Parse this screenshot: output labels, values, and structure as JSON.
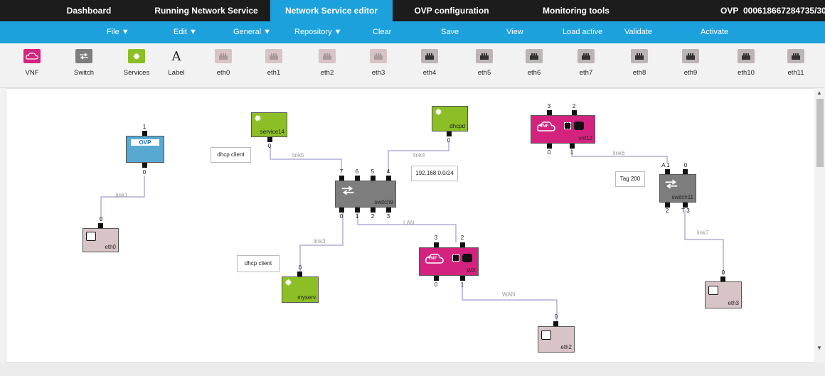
{
  "tabs": [
    "Dashboard",
    "Running Network Service",
    "Network Service editor",
    "OVP configuration",
    "Monitoring tools"
  ],
  "ovp": {
    "label": "OVP",
    "id": "000618667284735/30"
  },
  "menu": {
    "file": "File ▼",
    "edit": "Edit ▼",
    "general": "General ▼",
    "repository": "Repository ▼",
    "clear": "Clear",
    "save": "Save",
    "view": "View",
    "load_active": "Load active",
    "validate": "Validate",
    "activate": "Activate"
  },
  "palette": [
    "VNF",
    "Switch",
    "Services",
    "Label",
    "eth0",
    "eth1",
    "eth2",
    "eth3",
    "eth4",
    "eth5",
    "eth6",
    "eth7",
    "eth8",
    "eth9",
    "eth10",
    "eth11"
  ],
  "nodes": {
    "service14": "service14",
    "dhcpd": "dhcpd",
    "vnf12": "vnf12",
    "ovp_badge": "OVP",
    "switch9": "switch9",
    "switch11": "switch11",
    "eth0": "eth0",
    "myserv": "myserv",
    "wx": "WX",
    "eth3": "eth3",
    "eth2": "eth2",
    "vnf_badge": "VNF"
  },
  "notes": {
    "dhcp_client_1": "dhcp client",
    "subnet": "192.168.0.0/24",
    "tag": "Tag 200",
    "dhcp_client_2": "dhcp client"
  },
  "links": {
    "link1": "link1",
    "link3": "link3",
    "link4": "link4",
    "link5": "link5",
    "link6": "link6",
    "link7": "link7",
    "lan": "LAN",
    "wan": "WAN"
  },
  "ports": {
    "ovp_top": "1",
    "ovp_bottom": "0",
    "service14_bottom": "0",
    "dhcpd_bottom": "0",
    "switch9_top": [
      "7",
      "6",
      "5",
      "4"
    ],
    "switch9_bottom": [
      "0",
      "1",
      "2",
      "3"
    ],
    "vnf12_top": [
      "3",
      "2"
    ],
    "vnf12_bottom": [
      "0",
      "1"
    ],
    "switch11_top": [
      "A 1",
      "0"
    ],
    "switch11_bottom": [
      "2",
      "T 3"
    ],
    "eth0_top": "0",
    "myserv_top": "0",
    "wx_top": [
      "3",
      "2"
    ],
    "wx_bottom": [
      "0",
      "1"
    ],
    "eth3_top": "0",
    "eth2_top": "0"
  },
  "colors": {
    "tabbar": "#1c1c1c",
    "accent": "#1da1dc",
    "vnf": "#d4237f",
    "service": "#8cbf26",
    "eth": "#d8c3c6",
    "switch": "#7d7d7d",
    "ovp": "#57a9d2"
  }
}
